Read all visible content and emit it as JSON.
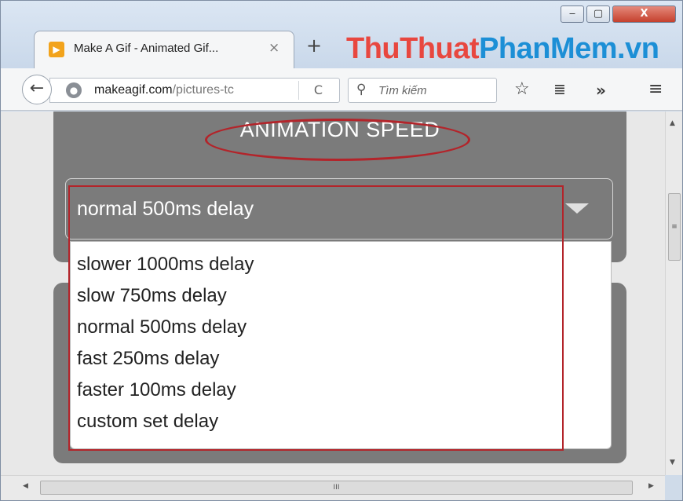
{
  "window": {
    "minimize": "‒",
    "maximize": "▢",
    "close": "X"
  },
  "tab": {
    "favicon": "▶",
    "title": "Make A Gif - Animated Gif...",
    "close": "×",
    "new_tab": "+"
  },
  "watermark": {
    "part1": "ThuThuat",
    "part2": "PhanMem",
    "part3": ".vn"
  },
  "nav": {
    "back": "←",
    "url_host": "makeagif.com",
    "url_path": "/pictures-tc",
    "reload": "C",
    "search_placeholder": "Tìm kiếm",
    "star": "☆",
    "reader": "≣",
    "more": "»",
    "menu": "≡"
  },
  "speed": {
    "title": "ANIMATION SPEED",
    "selected": "normal 500ms delay",
    "options": [
      "slower 1000ms delay",
      "slow 750ms delay",
      "normal 500ms delay",
      "fast 250ms delay",
      "faster 100ms delay",
      "custom set delay"
    ]
  },
  "scrollbar": {
    "grip": "≡",
    "h_grip": "III"
  },
  "colors": {
    "highlight": "#b3242a",
    "panel": "#7b7b7b"
  }
}
